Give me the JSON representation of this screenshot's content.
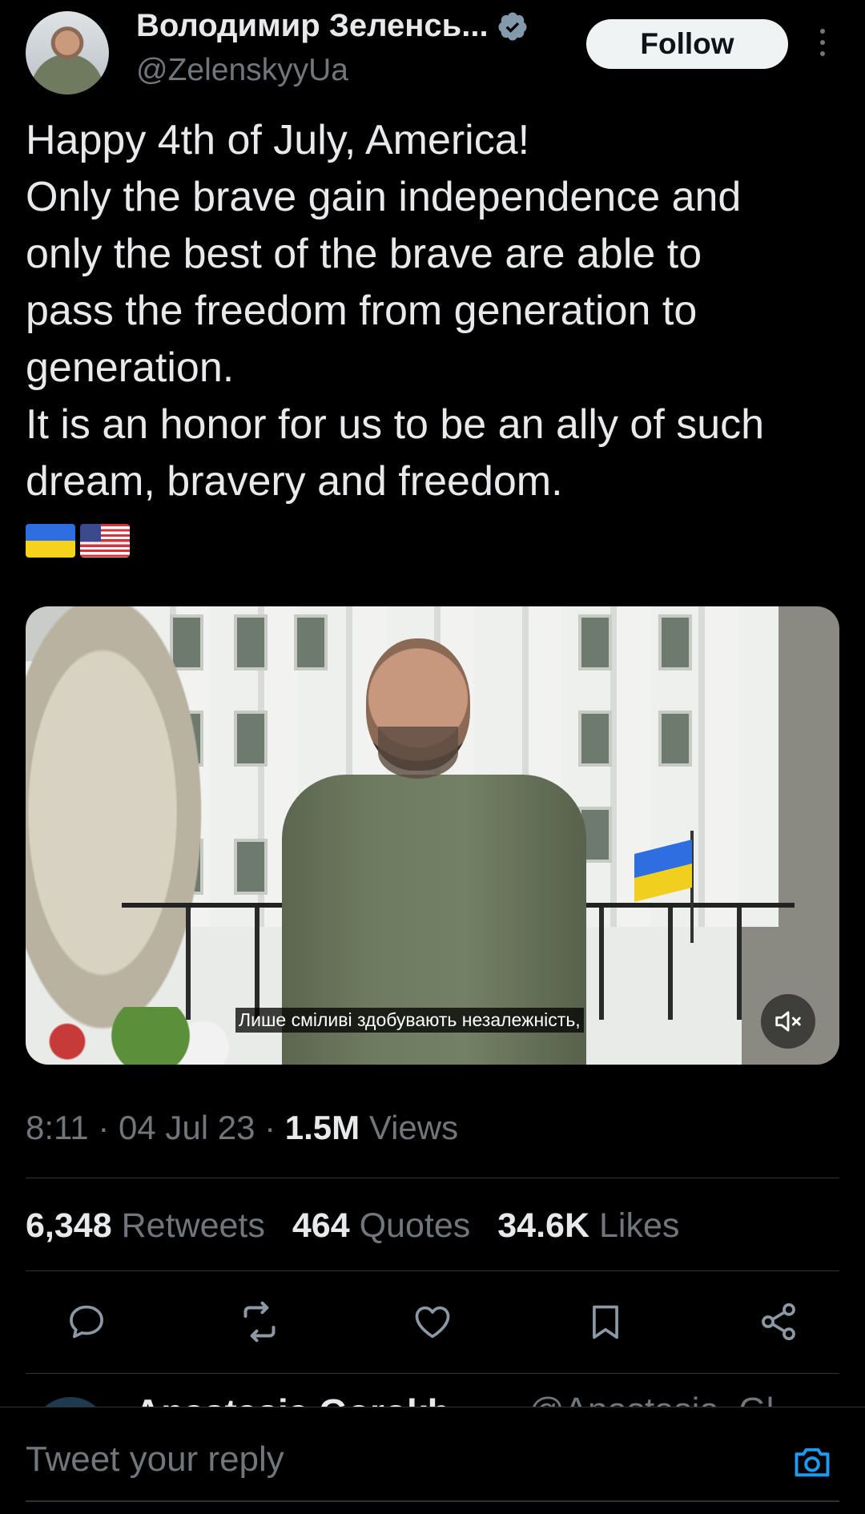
{
  "author": {
    "name": "Володимир Зеленсь...",
    "handle": "@ZelenskyyUa",
    "verified": true,
    "follow_label": "Follow"
  },
  "tweet": {
    "lines": [
      "Happy 4th of July, America!",
      "Only the brave gain independence and",
      "only the best of the brave are able to",
      "pass the freedom from generation to",
      "generation.",
      "It is an honor for us to be an ally of such",
      "dream, bravery and freedom."
    ],
    "flags": [
      "ukraine-flag-icon",
      "us-flag-icon"
    ]
  },
  "video": {
    "caption": "Лише сміливі здобувають незалежність,",
    "muted": true
  },
  "meta": {
    "time": "8:11",
    "date": "04 Jul 23",
    "views_count": "1.5M",
    "views_label": "Views"
  },
  "stats": {
    "retweets_count": "6,348",
    "retweets_label": "Retweets",
    "quotes_count": "464",
    "quotes_label": "Quotes",
    "likes_count": "34.6K",
    "likes_label": "Likes"
  },
  "actions": [
    "reply-icon",
    "retweet-icon",
    "like-icon",
    "bookmark-icon",
    "share-icon"
  ],
  "next_tweet": {
    "name": "Anastasia Gorokh",
    "handle": "@Anastasia_Gl..."
  },
  "reply": {
    "placeholder": "Tweet your reply"
  },
  "colors": {
    "background": "#000000",
    "text_primary": "#e7e9ea",
    "text_secondary": "#71767b",
    "accent": "#1d9bf0",
    "divider": "#2f3336"
  }
}
